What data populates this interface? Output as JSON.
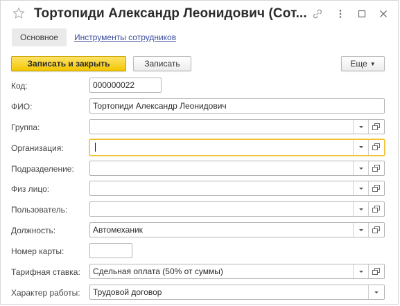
{
  "window": {
    "title": "Тортопиди Александр Леонидович (Сот...",
    "icons": [
      "star-icon",
      "link-icon",
      "more-vert-icon",
      "maximize-icon",
      "close-icon"
    ]
  },
  "tabs": {
    "main": "Основное",
    "tools": "Инструменты сотрудников"
  },
  "toolbar": {
    "save_close": "Записать и закрыть",
    "save": "Записать",
    "more": "Еще"
  },
  "form": {
    "code": {
      "label": "Код:",
      "value": "000000022"
    },
    "fio": {
      "label": "ФИО:",
      "value": "Тортопиди Александр Леонидович"
    },
    "group": {
      "label": "Группа:",
      "value": ""
    },
    "org": {
      "label": "Организация:",
      "value": ""
    },
    "dept": {
      "label": "Подразделение:",
      "value": ""
    },
    "person": {
      "label": "Физ лицо:",
      "value": ""
    },
    "user": {
      "label": "Пользователь:",
      "value": ""
    },
    "position": {
      "label": "Должность:",
      "value": "Автомеханик"
    },
    "card": {
      "label": "Номер карты:",
      "value": ""
    },
    "rate": {
      "label": "Тарифная ставка:",
      "value": "Сдельная оплата (50% от суммы)"
    },
    "work": {
      "label": "Характер работы:",
      "value": "Трудовой договор"
    }
  },
  "colors": {
    "primary_button": "#f3c600",
    "link": "#3c4d9e",
    "focus_border": "#f0c030"
  }
}
